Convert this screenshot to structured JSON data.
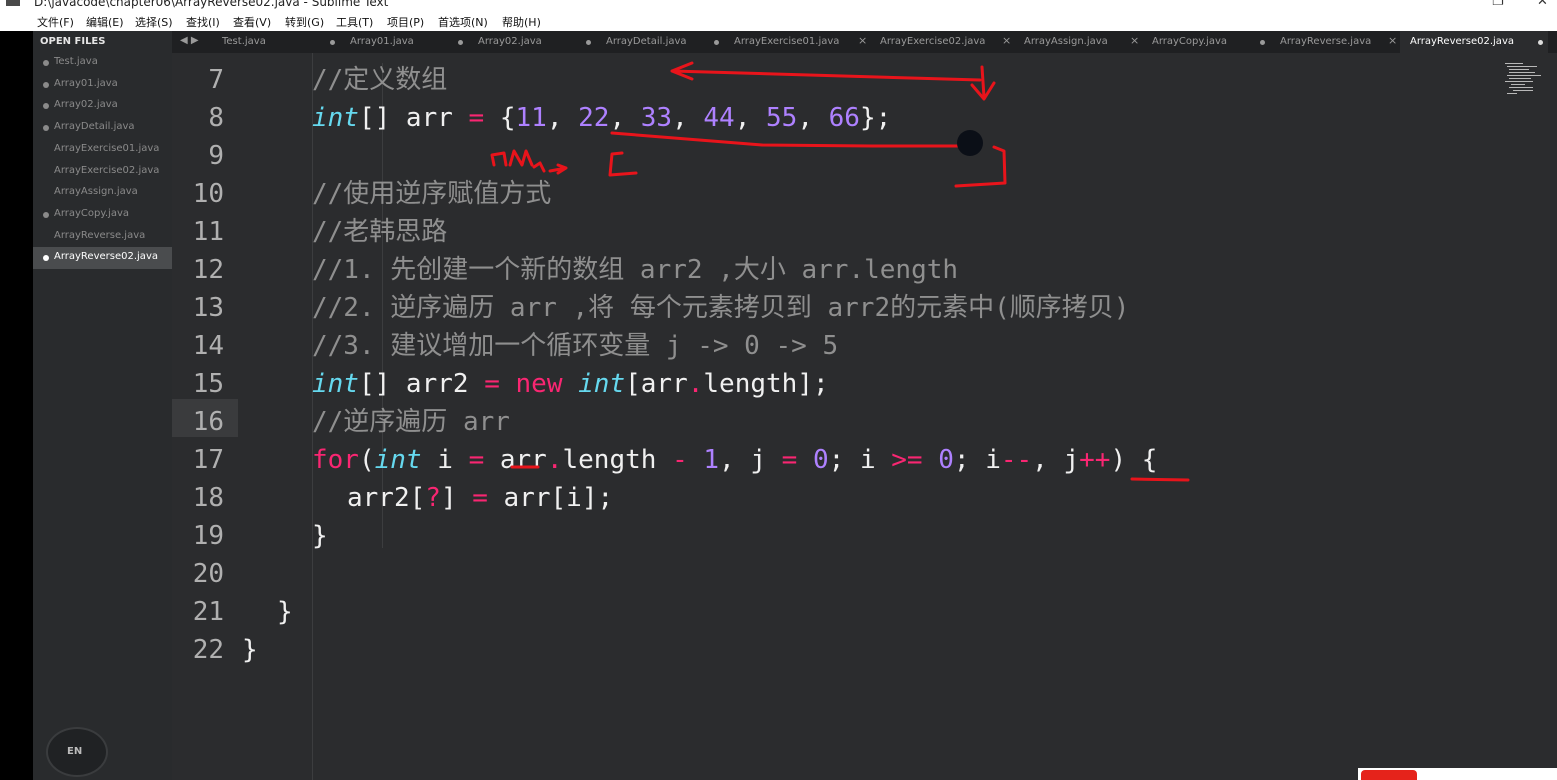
{
  "window": {
    "title": "D:\\javacode\\chapter06\\ArrayReverse02.java - Sublime Text"
  },
  "menu": [
    "文件(F)",
    "编辑(E)",
    "选择(S)",
    "查找(I)",
    "查看(V)",
    "转到(G)",
    "工具(T)",
    "项目(P)",
    "首选项(N)",
    "帮助(H)"
  ],
  "sidebar": {
    "header": "OPEN FILES",
    "items": [
      {
        "label": "Test.java",
        "dot": true
      },
      {
        "label": "Array01.java",
        "dot": true
      },
      {
        "label": "Array02.java",
        "dot": true
      },
      {
        "label": "ArrayDetail.java",
        "dot": true
      },
      {
        "label": "ArrayExercise01.java",
        "dot": false
      },
      {
        "label": "ArrayExercise02.java",
        "dot": false
      },
      {
        "label": "ArrayAssign.java",
        "dot": false
      },
      {
        "label": "ArrayCopy.java",
        "dot": true
      },
      {
        "label": "ArrayReverse.java",
        "dot": false
      },
      {
        "label": "ArrayReverse02.java",
        "dot": true,
        "active": true
      }
    ]
  },
  "tabs": [
    {
      "label": "Test.java",
      "close": "dot"
    },
    {
      "label": "Array01.java",
      "close": "dot"
    },
    {
      "label": "Array02.java",
      "close": "dot"
    },
    {
      "label": "ArrayDetail.java",
      "close": "dot"
    },
    {
      "label": "ArrayExercise01.java",
      "close": "x"
    },
    {
      "label": "ArrayExercise02.java",
      "close": "x"
    },
    {
      "label": "ArrayAssign.java",
      "close": "x"
    },
    {
      "label": "ArrayCopy.java",
      "close": "dot"
    },
    {
      "label": "ArrayReverse.java",
      "close": "x"
    },
    {
      "label": "ArrayReverse02.java",
      "close": "dot",
      "active": true
    }
  ],
  "editor": {
    "line_numbers": [
      "7",
      "8",
      "9",
      "10",
      "11",
      "12",
      "13",
      "14",
      "15",
      "16",
      "17",
      "18",
      "19",
      "20",
      "21",
      "22"
    ],
    "current_line": "16",
    "lines": [
      {
        "indent": 4,
        "tokens": [
          [
            "cm",
            "//定义数组"
          ]
        ]
      },
      {
        "indent": 4,
        "tokens": [
          [
            "ty",
            "int"
          ],
          [
            "p",
            "[] arr "
          ],
          [
            "op",
            "="
          ],
          [
            "p",
            " {"
          ],
          [
            "num",
            "11"
          ],
          [
            "p",
            ", "
          ],
          [
            "num",
            "22"
          ],
          [
            "p",
            ", "
          ],
          [
            "num",
            "33"
          ],
          [
            "p",
            ", "
          ],
          [
            "num",
            "44"
          ],
          [
            "p",
            ", "
          ],
          [
            "num",
            "55"
          ],
          [
            "p",
            ", "
          ],
          [
            "num",
            "66"
          ],
          [
            "p",
            "};"
          ]
        ]
      },
      {
        "indent": 0,
        "tokens": []
      },
      {
        "indent": 4,
        "tokens": [
          [
            "cm",
            "//使用逆序赋值方式"
          ]
        ]
      },
      {
        "indent": 4,
        "tokens": [
          [
            "cm",
            "//老韩思路"
          ]
        ]
      },
      {
        "indent": 4,
        "tokens": [
          [
            "cm",
            "//1. 先创建一个新的数组 arr2 ,大小 arr.length"
          ]
        ]
      },
      {
        "indent": 4,
        "tokens": [
          [
            "cm",
            "//2. 逆序遍历 arr ,将 每个元素拷贝到 arr2的元素中(顺序拷贝)"
          ]
        ]
      },
      {
        "indent": 4,
        "tokens": [
          [
            "cm",
            "//3. 建议增加一个循环变量 j -> 0 -> 5"
          ]
        ]
      },
      {
        "indent": 4,
        "tokens": [
          [
            "ty",
            "int"
          ],
          [
            "p",
            "[] arr2 "
          ],
          [
            "op",
            "="
          ],
          [
            "p",
            " "
          ],
          [
            "kw",
            "new"
          ],
          [
            "p",
            " "
          ],
          [
            "ty",
            "int"
          ],
          [
            "p",
            "[arr"
          ],
          [
            "op",
            "."
          ],
          [
            "p",
            "length];"
          ]
        ]
      },
      {
        "indent": 4,
        "tokens": [
          [
            "cm",
            "//逆序遍历 arr"
          ]
        ]
      },
      {
        "indent": 4,
        "tokens": [
          [
            "kw",
            "for"
          ],
          [
            "p",
            "("
          ],
          [
            "ty",
            "int"
          ],
          [
            "p",
            " i "
          ],
          [
            "op",
            "="
          ],
          [
            "p",
            " arr"
          ],
          [
            "op",
            "."
          ],
          [
            "p",
            "length "
          ],
          [
            "op",
            "-"
          ],
          [
            "p",
            " "
          ],
          [
            "num",
            "1"
          ],
          [
            "p",
            ", j "
          ],
          [
            "op",
            "="
          ],
          [
            "p",
            " "
          ],
          [
            "num",
            "0"
          ],
          [
            "p",
            "; i "
          ],
          [
            "op",
            ">="
          ],
          [
            "p",
            " "
          ],
          [
            "num",
            "0"
          ],
          [
            "p",
            "; i"
          ],
          [
            "op",
            "--"
          ],
          [
            "p",
            ", j"
          ],
          [
            "op",
            "++"
          ],
          [
            "p",
            ") {"
          ]
        ]
      },
      {
        "indent": 6,
        "tokens": [
          [
            "p",
            "arr2["
          ],
          [
            "op",
            "?"
          ],
          [
            "p",
            "] "
          ],
          [
            "op",
            "="
          ],
          [
            "p",
            " arr[i];"
          ]
        ]
      },
      {
        "indent": 4,
        "tokens": [
          [
            "p",
            "}"
          ]
        ]
      },
      {
        "indent": 0,
        "tokens": []
      },
      {
        "indent": 2,
        "tokens": [
          [
            "p",
            "}"
          ]
        ]
      },
      {
        "indent": 0,
        "tokens": [
          [
            "p",
            "}"
          ]
        ]
      }
    ]
  },
  "ime_badge": "EN",
  "colors": {
    "annotation_red": "#e8141b",
    "keyword": "#f92672",
    "type": "#66d9ef",
    "number": "#ae81ff",
    "comment": "#8f8f8f"
  }
}
